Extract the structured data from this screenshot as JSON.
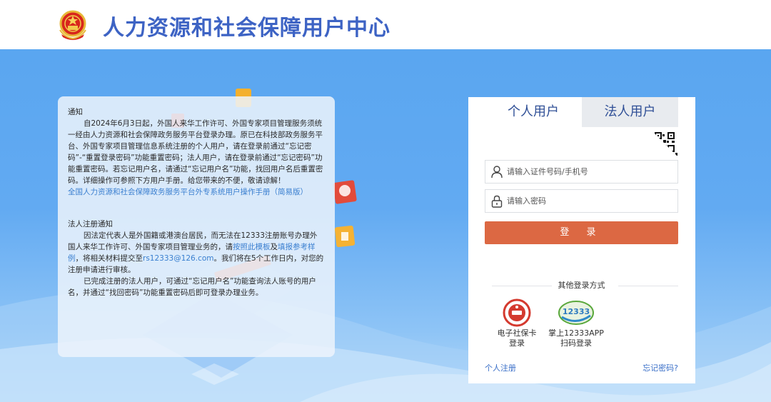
{
  "header": {
    "title": "人力资源和社会保障用户中心"
  },
  "notice": {
    "title": "通知",
    "body": "自2024年6月3日起，外国人来华工作许可、外国专家项目管理服务须统一经由人力资源和社会保障政务服务平台登录办理。原已在科技部政务服务平台、外国专家项目管理信息系统注册的个人用户，请在登录前通过“忘记密码”-“重置登录密码”功能重置密码；法人用户，请在登录前通过“忘记密码”功能重置密码。若忘记用户名，请通过“忘记用户名”功能，找回用户名后重置密码。详细操作可参照下方用户手册。给您带来的不便，敬请谅解！",
    "manual_link": "全国人力资源和社会保障政务服务平台外专系统用户操作手册（简易版）",
    "legal_title": "法人注册通知",
    "legal_p1_a": "因法定代表人是外国籍或港澳台居民，而无法在12333注册账号办理外国人来华工作许可、外国专家项目管理业务的，请",
    "legal_template_link": "按照此模板",
    "legal_p1_b": "及",
    "legal_sample_link": "填报参考样例",
    "legal_p1_c": "，将相关材料提交至",
    "legal_email": "rs12333@126.com",
    "legal_p1_d": "。我们将在5个工作日内，对您的注册申请进行审核。",
    "legal_p2": "已完成注册的法人用户，可通过“忘记用户名”功能查询法人账号的用户名，并通过“找回密码”功能重置密码后即可登录办理业务。"
  },
  "login": {
    "tab_personal": "个人用户",
    "tab_legal": "法人用户",
    "username_placeholder": "请输入证件号码/手机号",
    "password_placeholder": "请输入密码",
    "submit_label": "登 录",
    "other_methods": "其他登录方式",
    "method_card_line1": "电子社保卡",
    "method_card_line2": "登录",
    "method_app_line1": "掌上12333APP",
    "method_app_line2": "扫码登录",
    "register_link": "个人注册",
    "forgot_link": "忘记密码?"
  },
  "icons": {
    "emblem": "national-emblem-icon",
    "qr": "qr-code-icon",
    "user": "user-icon",
    "lock": "lock-icon",
    "social_card": "social-security-card-icon",
    "app": "12333-app-icon"
  },
  "colors": {
    "title": "#3d63c4",
    "login_button": "#dc6843",
    "link": "#3a6fc8",
    "banner": "#5aa6f0"
  }
}
